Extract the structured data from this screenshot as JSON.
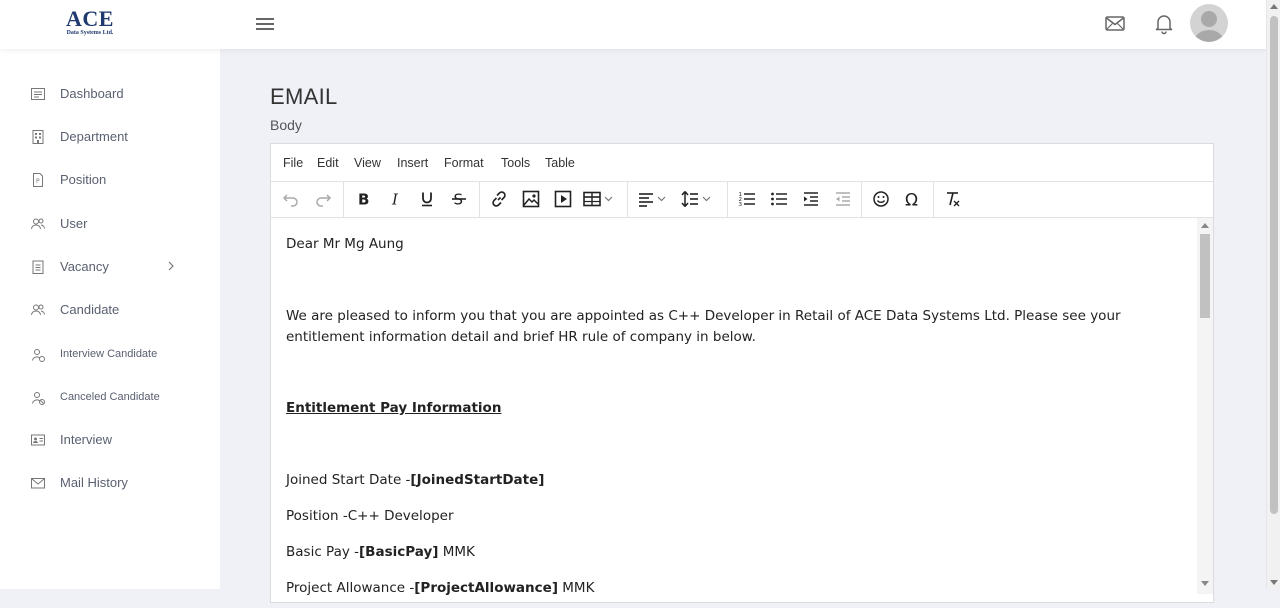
{
  "header": {
    "logo_main": "ACE",
    "logo_sub": "Data Systems Ltd."
  },
  "sidebar": {
    "items": [
      {
        "label": "Dashboard",
        "icon": "dashboard-icon"
      },
      {
        "label": "Department",
        "icon": "building-icon"
      },
      {
        "label": "Position",
        "icon": "document-icon"
      },
      {
        "label": "User",
        "icon": "users-icon"
      },
      {
        "label": "Vacancy",
        "icon": "clipboard-icon"
      },
      {
        "label": "Candidate",
        "icon": "users-icon"
      },
      {
        "label": "Interview Candidate",
        "icon": "user-check-icon"
      },
      {
        "label": "Canceled Candidate",
        "icon": "user-x-icon"
      },
      {
        "label": "Interview",
        "icon": "id-card-icon"
      },
      {
        "label": "Mail History",
        "icon": "mail-icon"
      }
    ]
  },
  "main": {
    "title": "EMAIL",
    "body_label": "Body"
  },
  "editor": {
    "menu": [
      "File",
      "Edit",
      "View",
      "Insert",
      "Format",
      "Tools",
      "Table"
    ],
    "content": {
      "greeting": "Dear Mr Mg Aung",
      "intro": "We are pleased to inform you that you are appointed as C++ Developer in Retail of ACE Data Systems Ltd. Please see your entitlement information detail and brief HR rule of company in below.",
      "section_heading": "Entitlement Pay Information",
      "joined_label": "Joined Start Date -",
      "joined_value": "[JoinedStartDate]",
      "position_line": "Position -C++ Developer",
      "basic_label": "Basic Pay -",
      "basic_value": "[BasicPay]",
      "basic_unit": " MMK",
      "project_label": "Project Allowance -",
      "project_value": "[ProjectAllowance]",
      "project_unit": " MMK"
    }
  },
  "colors": {
    "brand": "#1f3a6e",
    "background": "#f0f1f7"
  }
}
